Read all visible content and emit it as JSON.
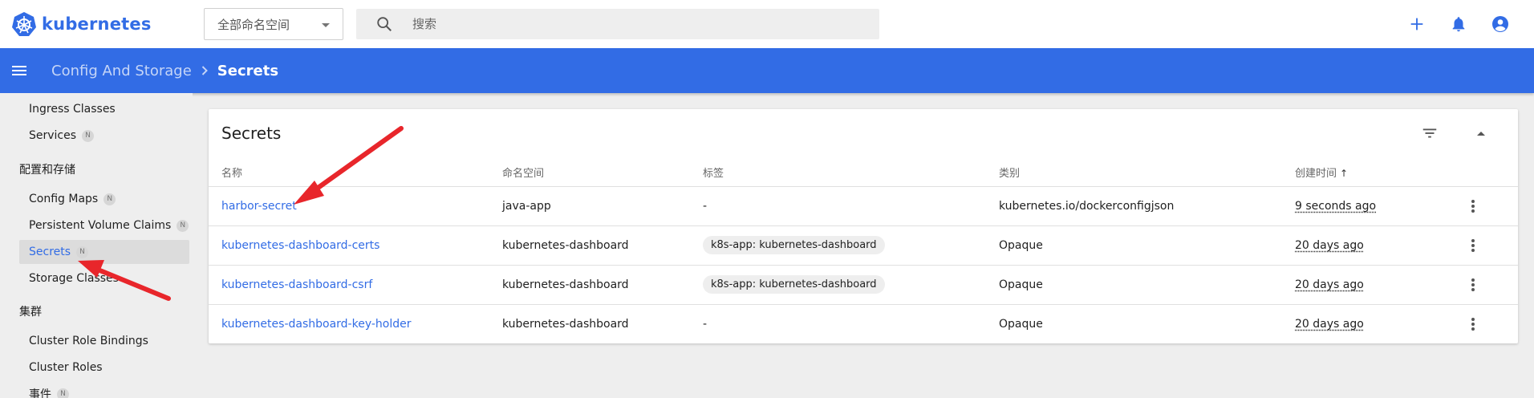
{
  "brand": {
    "name": "kubernetes",
    "color": "#326ce5"
  },
  "namespace_select": {
    "value": "全部命名空间"
  },
  "search": {
    "placeholder": "搜索"
  },
  "breadcrumb": {
    "parent": "Config And Storage",
    "current": "Secrets"
  },
  "sidebar": {
    "items": [
      {
        "label": "Ingress Classes",
        "badge": ""
      },
      {
        "label": "Services",
        "badge": "N"
      }
    ],
    "section_config": "配置和存储",
    "config_items": [
      {
        "label": "Config Maps",
        "badge": "N"
      },
      {
        "label": "Persistent Volume Claims",
        "badge": "N"
      },
      {
        "label": "Secrets",
        "badge": "N"
      },
      {
        "label": "Storage Classes",
        "badge": ""
      }
    ],
    "section_cluster": "集群",
    "cluster_items": [
      {
        "label": "Cluster Role Bindings",
        "badge": ""
      },
      {
        "label": "Cluster Roles",
        "badge": ""
      },
      {
        "label": "事件",
        "badge": "N"
      }
    ]
  },
  "card": {
    "title": "Secrets",
    "columns": [
      "名称",
      "命名空间",
      "标签",
      "类别",
      "创建时间"
    ],
    "sort_indicator": "↑",
    "rows": [
      {
        "name": "harbor-secret",
        "namespace": "java-app",
        "label": "-",
        "type": "kubernetes.io/dockerconfigjson",
        "created": "9 seconds ago"
      },
      {
        "name": "kubernetes-dashboard-certs",
        "namespace": "kubernetes-dashboard",
        "label": "k8s-app: kubernetes-dashboard",
        "type": "Opaque",
        "created": "20 days ago"
      },
      {
        "name": "kubernetes-dashboard-csrf",
        "namespace": "kubernetes-dashboard",
        "label": "k8s-app: kubernetes-dashboard",
        "type": "Opaque",
        "created": "20 days ago"
      },
      {
        "name": "kubernetes-dashboard-key-holder",
        "namespace": "kubernetes-dashboard",
        "label": "-",
        "type": "Opaque",
        "created": "20 days ago"
      }
    ]
  },
  "icons": {
    "logo": "kubernetes-wheel-icon",
    "search": "search-icon",
    "add": "plus-icon",
    "notifications": "bell-icon",
    "account": "account-circle-icon",
    "menu": "hamburger-menu-icon",
    "filter": "filter-icon",
    "collapse": "caret-up-icon",
    "row_actions": "more-vert-icon"
  },
  "annotation_color": "#e8262b"
}
